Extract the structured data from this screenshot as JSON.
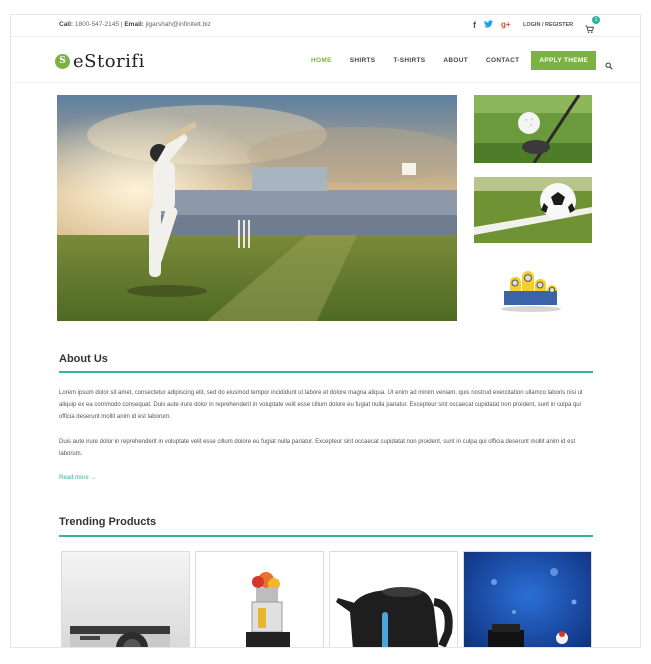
{
  "topbar": {
    "call_label": "Call:",
    "phone": "1800-547-2145",
    "separator": "|",
    "email_label": "Email:",
    "email": "jigarshah@infinitelt.biz",
    "social": {
      "facebook": "f",
      "twitter": "t",
      "googleplus": "g+"
    },
    "login_register": "LOGIN / REGISTER",
    "cart_count": "1"
  },
  "brand": {
    "mark": "S",
    "name": "eStorifi",
    "accent_color": "#7ab342",
    "teal_color": "#2fb59b"
  },
  "nav": {
    "items": [
      "HOME",
      "SHIRTS",
      "T-SHIRTS",
      "ABOUT",
      "CONTACT"
    ],
    "active": "HOME",
    "cta": "APPLY THEME"
  },
  "about": {
    "title": "About Us",
    "para1": "Lorem ipsum dolor sit amet, consectetur adipiscing elit, sed do eiusmod tempor incididunt ut labore et dolore magna aliqua. Ut enim ad minim veniam, quis nostrud exercitation ullamco laboris nisi ut aliquip ex ea commodo consequat. Duis aute irure dolor in reprehenderit in voluptate velit esse cillum dolore eu fugiat nulla pariatur. Excepteur sint occaecat cupidatat non proident, sunt in culpa qui officia deserunt mollit anim id est laborum.",
    "para2": "Duis aute irure dolor in reprehenderit in voluptate velit esse cillum dolore eu fugiat nulla pariatur. Excepteur sint occaecat cupidatat non proident, sunt in culpa qui officia deserunt mollit anim id est laborum.",
    "read_more": "Read more →"
  },
  "trending": {
    "title": "Trending Products",
    "products": [
      "camera",
      "juicer",
      "kettle",
      "bottle"
    ]
  },
  "icons": {
    "cart": "cart-icon",
    "search": "search-icon",
    "logo": "logo-icon"
  }
}
